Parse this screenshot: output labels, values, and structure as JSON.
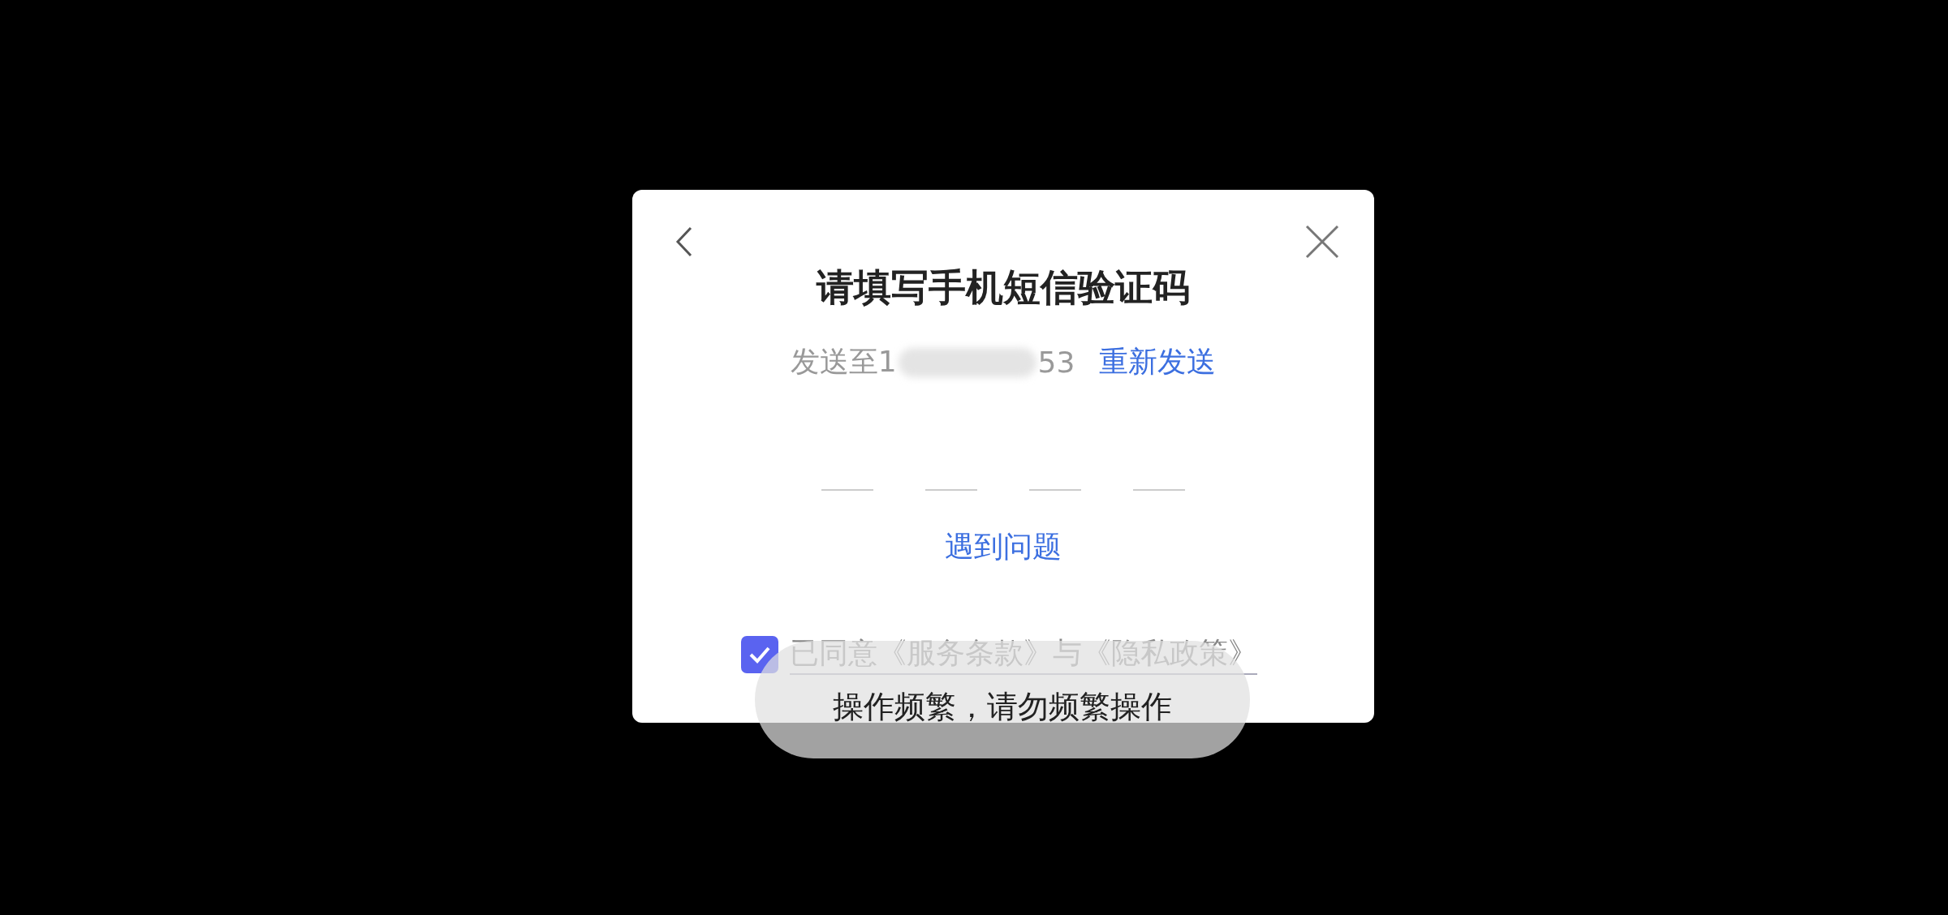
{
  "dialog": {
    "title": "请填写手机短信验证码",
    "sent_to": {
      "label": "发送至",
      "phone_start": "1",
      "phone_end": "53",
      "redacted": true
    },
    "resend_link": "重新发送",
    "code_slots": [
      {
        "filled": false
      },
      {
        "filled": false
      },
      {
        "filled": false
      },
      {
        "filled": false
      }
    ],
    "help_link": "遇到问题",
    "agreement": {
      "checked": true,
      "text": "已同意《服务条款》与《隐私政策》"
    }
  },
  "toast": {
    "message": "操作频繁，请勿频繁操作"
  }
}
